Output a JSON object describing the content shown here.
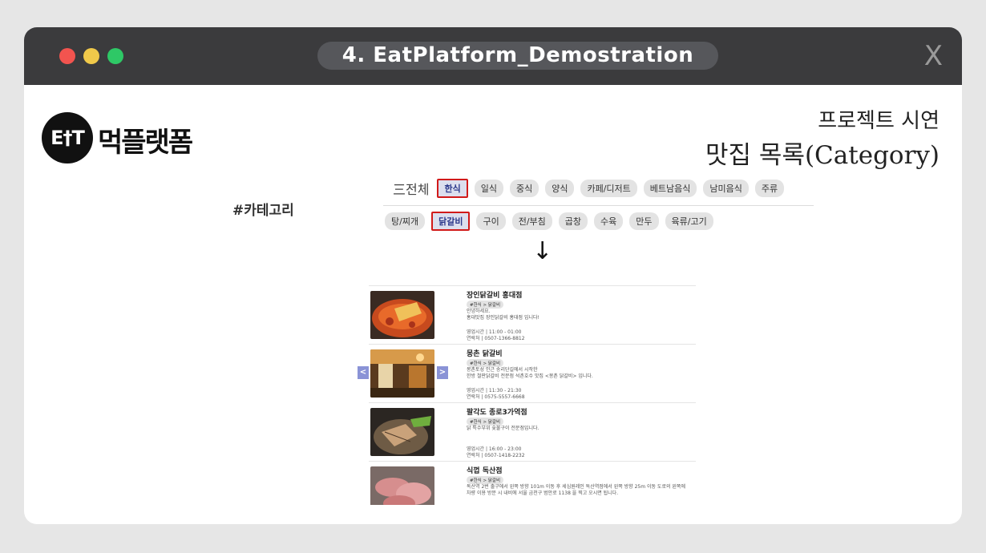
{
  "window": {
    "title": "4. EatPlatform_Demostration",
    "close_label": "X"
  },
  "brand": {
    "logo_mark": "E†T",
    "logo_text": "먹플랫폼"
  },
  "header": {
    "subtitle": "프로젝트 시연",
    "title": "맛집 목록(Category)"
  },
  "section_label": "#카테고리",
  "category_tabs": {
    "all_label": "三전체",
    "primary": [
      "한식",
      "일식",
      "중식",
      "양식",
      "카페/디저트",
      "베트남음식",
      "남미음식",
      "주류"
    ],
    "primary_selected": "한식",
    "secondary": [
      "탕/찌개",
      "닭갈비",
      "구이",
      "전/부침",
      "곱창",
      "수육",
      "만두",
      "육류/고기"
    ],
    "secondary_selected": "닭갈비"
  },
  "arrow_symbol": "↓",
  "carousel": {
    "prev_label": "<",
    "next_label": ">"
  },
  "restaurants": [
    {
      "name": "장인닭갈비 홍대점",
      "tag": "#한식 > 닭갈비",
      "desc": "안녕하세요.\n홍대맛집 장인닭갈비 홍대점 입니다!",
      "hours": "영업시간 | 11:00 - 01:00",
      "phone": "연락처 | 0507-1366-8812"
    },
    {
      "name": "몽촌 닭갈비",
      "tag": "#한식 > 닭갈비",
      "desc": "몽촌토성 인근 송리단길에서 시작한\n한방 철판닭갈비 전문점 석촌호수 맛집 <몽촌 닭갈비> 입니다.",
      "hours": "영업시간 | 11:30 - 21:30",
      "phone": "연락처 | 0575-5557-6668"
    },
    {
      "name": "팔각도 종로3가역점",
      "tag": "#한식 > 닭갈비",
      "desc": "닭 특수부위 숯불구이 전문점입니다.",
      "hours": "영업시간 | 16:00 - 23:00",
      "phone": "연락처 | 0507-1418-2232"
    },
    {
      "name": "식껍 독산점",
      "tag": "#한식 > 닭갈비",
      "desc": "독산역 2번 출구에서 왼쪽 방향 101m 이동 후 세심원레인 독산역점에서 왼쪽 방향 25m 이동 도로의 왼쪽에\n차량 이용 방문 시 내비에 서울 금천구 범안로 1138 을 찍고 오시면 됩니다.",
      "hours": "",
      "phone": ""
    }
  ]
}
